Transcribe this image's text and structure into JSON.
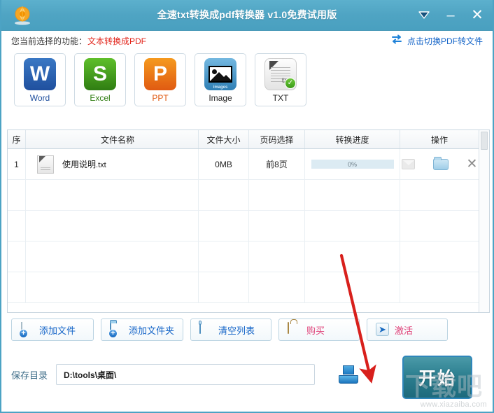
{
  "window": {
    "title": "全速txt转换成pdf转换器 v1.0免费试用版",
    "logo_icon": "app-logo-icon",
    "controls": {
      "menu_icon": "chevron-down-icon",
      "minimize_label": "–",
      "close_label": "✕"
    }
  },
  "function_bar": {
    "label": "您当前选择的功能：",
    "value": "文本转换成PDF",
    "switch_icon": "swap-arrows-icon",
    "switch_label": "点击切换PDF转文件"
  },
  "formats": [
    {
      "label": "Word",
      "icon": "word-icon",
      "glyph": "W"
    },
    {
      "label": "Excel",
      "icon": "excel-icon",
      "glyph": "S"
    },
    {
      "label": "PPT",
      "icon": "ppt-icon",
      "glyph": "P"
    },
    {
      "label": "Image",
      "icon": "image-icon",
      "caption": "images"
    },
    {
      "label": "TXT",
      "icon": "txt-icon",
      "glyph": "txt",
      "checked": true
    }
  ],
  "table": {
    "headers": [
      "序",
      "文件名称",
      "文件大小",
      "页码选择",
      "转换进度",
      "操作"
    ],
    "rows": [
      {
        "index": "1",
        "file_icon": "txt-file-icon",
        "name": "使用说明",
        "ext": ".txt",
        "size": "0MB",
        "pages": "前8页",
        "progress": "0%",
        "progress_value": 0,
        "actions": [
          "preview-icon",
          "open-folder-icon",
          "remove-icon"
        ]
      }
    ],
    "empty_rows": 4
  },
  "toolbar": {
    "add_file": {
      "label": "添加文件",
      "icon": "add-file-icon"
    },
    "add_folder": {
      "label": "添加文件夹",
      "icon": "add-folder-icon"
    },
    "clear_list": {
      "label": "清空列表",
      "icon": "trash-icon"
    },
    "buy": {
      "label": "购买",
      "icon": "shopping-bag-icon"
    },
    "activate": {
      "label": "激活",
      "icon": "arrow-right-icon"
    }
  },
  "save_row": {
    "label": "保存目录",
    "path": "D:\\tools\\桌面\\",
    "browse_icon": "save-tray-icon"
  },
  "start_button": {
    "label": "开始"
  },
  "watermark": {
    "text": "www.xiazaiba.com",
    "glyph": "下载吧"
  },
  "colors": {
    "titlebar": "#4fa4c3",
    "accent_link": "#1565c8",
    "accent_red": "#e2261c",
    "accent_pink": "#e0457b",
    "start_button": "#2d7f90",
    "border": "#4ca3c4",
    "annotation_arrow": "#d8201c"
  }
}
